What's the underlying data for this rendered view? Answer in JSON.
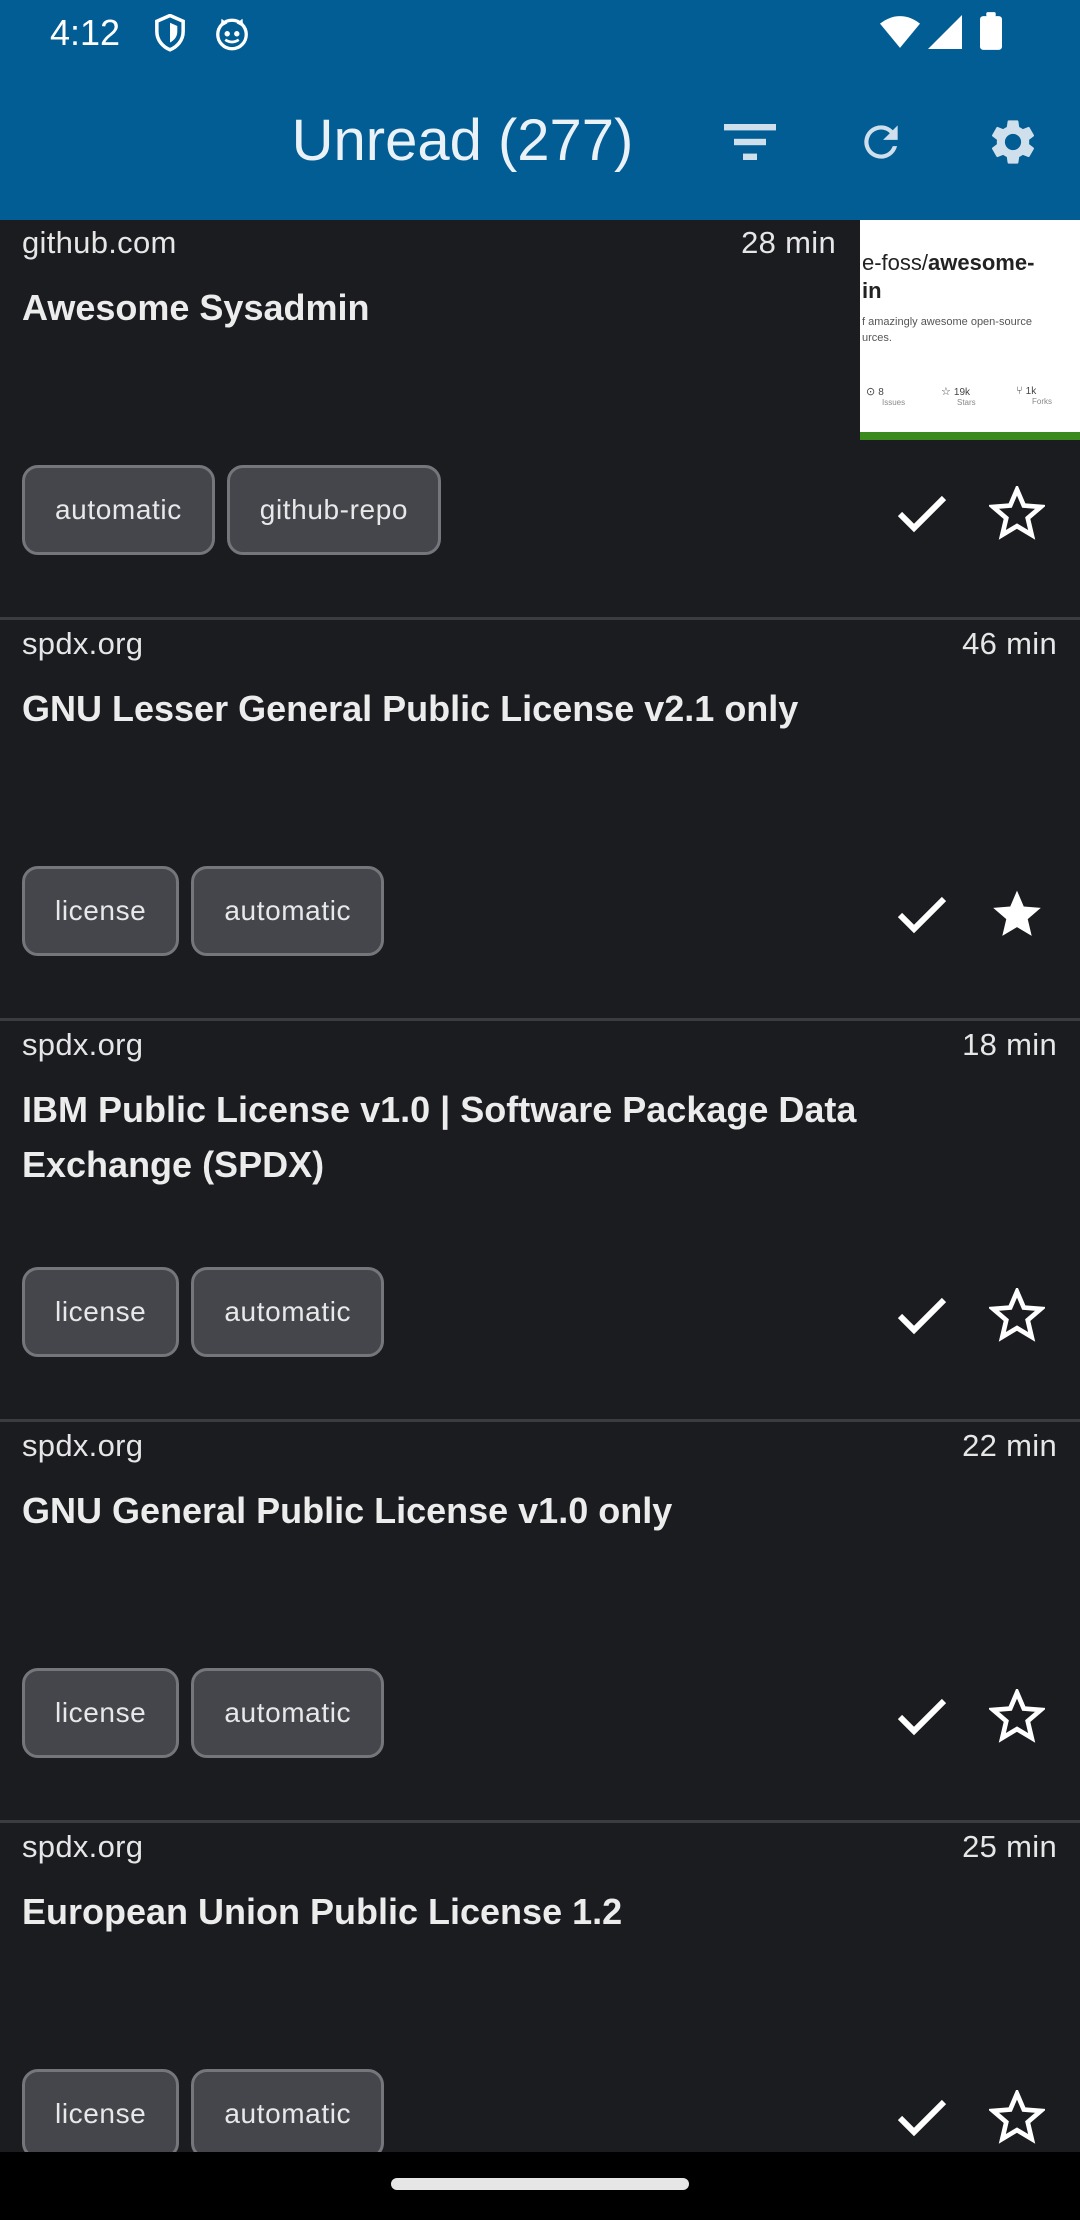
{
  "status_bar": {
    "time": "4:12",
    "left_icons": [
      "shield-icon",
      "cat-icon"
    ],
    "right_icons": [
      "wifi-icon",
      "signal-icon",
      "battery-icon"
    ]
  },
  "app_bar": {
    "title": "Unread (277)",
    "actions": [
      "filter-icon",
      "refresh-icon",
      "settings-icon"
    ],
    "background": "#015d94"
  },
  "articles": [
    {
      "source": "github.com",
      "time": "28 min",
      "title": "Awesome Sysadmin",
      "tags": [
        "automatic",
        "github-repo"
      ],
      "starred": false,
      "thumbnail": {
        "path_text": "e-foss/",
        "path_bold": "awesome-",
        "path_bold2": "in",
        "description": "f amazingly awesome open-source",
        "description2": "urces.",
        "stats": [
          {
            "value": "8",
            "label": "Issues"
          },
          {
            "value": "19k",
            "label": "Stars"
          },
          {
            "value": "1k",
            "label": "Forks"
          }
        ]
      }
    },
    {
      "source": "spdx.org",
      "time": "46 min",
      "title": "GNU Lesser General Public License v2.1 only",
      "tags": [
        "license",
        "automatic"
      ],
      "starred": true
    },
    {
      "source": "spdx.org",
      "time": "18 min",
      "title": "IBM Public License v1.0 | Software Package Data Exchange (SPDX)",
      "tags": [
        "license",
        "automatic"
      ],
      "starred": false
    },
    {
      "source": "spdx.org",
      "time": "22 min",
      "title": "GNU General Public License v1.0 only",
      "tags": [
        "license",
        "automatic"
      ],
      "starred": false
    },
    {
      "source": "spdx.org",
      "time": "25 min",
      "title": "European Union Public License 1.2",
      "tags": [
        "license",
        "automatic"
      ],
      "starred": false
    }
  ],
  "colors": {
    "background": "#1b1c20",
    "tag_fill": "#44464c",
    "tag_border": "#74767c",
    "divider": "#3b3c40"
  }
}
